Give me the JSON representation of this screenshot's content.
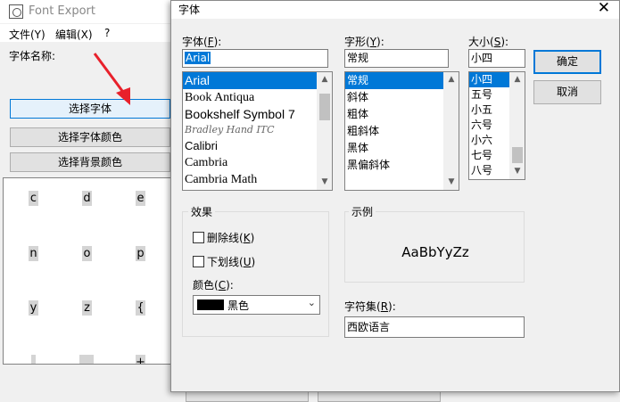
{
  "bg": {
    "title": "Font Export",
    "menu": [
      "文件(Y)",
      "编辑(X)",
      "?"
    ],
    "font_name_label": "字体名称:",
    "buttons": {
      "choose_font": "选择字体",
      "font_color": "选择字体颜色",
      "bg_color": "选择背景颜色"
    },
    "glyphs": [
      "c",
      "d",
      "e",
      "n",
      "o",
      "p",
      "y",
      "z",
      "{",
      "",
      "",
      "+"
    ]
  },
  "dialog": {
    "title": "字体",
    "close": "✕",
    "font_label": "字体",
    "font_key": "F",
    "style_label": "字形",
    "style_key": "Y",
    "size_label": "大小",
    "size_key": "S",
    "font_value": "Arial",
    "style_value": "常规",
    "size_value": "小四",
    "fonts": [
      "Arial",
      "Book Antiqua",
      "Bookshelf Symbol 7",
      "Bradley Hand ITC",
      "Calibri",
      "Cambria",
      "Cambria Math"
    ],
    "styles": [
      "常规",
      "斜体",
      "粗体",
      "粗斜体",
      "黑体",
      "黑偏斜体"
    ],
    "sizes": [
      "小四",
      "五号",
      "小五",
      "六号",
      "小六",
      "七号",
      "八号"
    ],
    "ok": "确定",
    "cancel": "取消",
    "effects_title": "效果",
    "strikeout_label": "删除线",
    "strikeout_key": "K",
    "underline_label": "下划线",
    "underline_key": "U",
    "color_label": "颜色",
    "color_key": "C",
    "color_value": "黑色",
    "sample_title": "示例",
    "sample_text": "AaBbYyZz",
    "charset_label": "字符集",
    "charset_key": "R",
    "charset_value": "西欧语言"
  },
  "colors": {
    "selection": "#0078d7",
    "dialog_bg": "#f0f0f0",
    "callout_arrow": "#e8212b"
  }
}
